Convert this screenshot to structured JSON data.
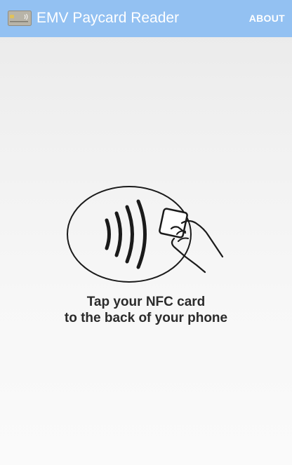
{
  "action_bar": {
    "icon": "credit-card-icon",
    "title": "EMV Paycard Reader",
    "about_label": "ABOUT",
    "background_color": "#93c1f2"
  },
  "main": {
    "illustration": "contactless-tap-icon",
    "instruction_line1": "Tap your NFC card",
    "instruction_line2": "to the back of your phone"
  }
}
